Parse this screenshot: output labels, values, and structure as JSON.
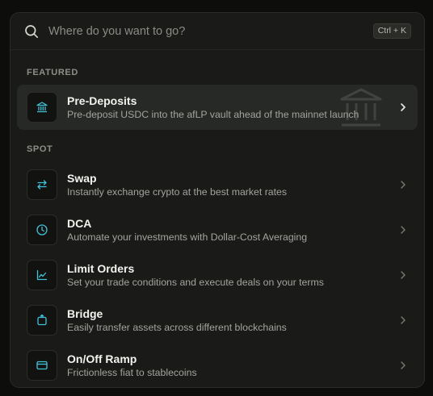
{
  "search": {
    "placeholder": "Where do you want to go?",
    "shortcut": "Ctrl + K"
  },
  "featured": {
    "label": "FEATURED",
    "item": {
      "title": "Pre-Deposits",
      "description": "Pre-deposit USDC into the afLP vault ahead of the mainnet launch",
      "icon": "bank-icon"
    }
  },
  "spot": {
    "label": "SPOT",
    "items": [
      {
        "title": "Swap",
        "description": "Instantly exchange crypto at the best market rates",
        "icon": "swap-arrows-icon"
      },
      {
        "title": "DCA",
        "description": "Automate your investments with Dollar-Cost Averaging",
        "icon": "clock-icon"
      },
      {
        "title": "Limit Orders",
        "description": "Set your trade conditions and execute deals on your terms",
        "icon": "chart-line-icon"
      },
      {
        "title": "Bridge",
        "description": "Easily transfer assets across different blockchains",
        "icon": "bridge-transfer-icon"
      },
      {
        "title": "On/Off Ramp",
        "description": "Frictionless fiat to stablecoins",
        "icon": "card-icon"
      }
    ]
  },
  "colors": {
    "accent": "#3fc3d9",
    "panel": "#1a1a18",
    "featured_bg": "#262925"
  }
}
